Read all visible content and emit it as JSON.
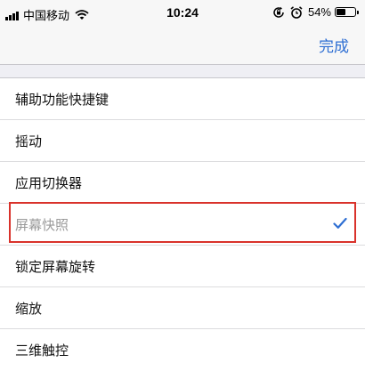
{
  "status_bar": {
    "carrier": "中国移动",
    "time": "10:24",
    "battery_percent": "54%",
    "battery_level": 0.54,
    "icons": [
      "signal-icon",
      "wifi-icon",
      "orientation-lock-icon",
      "alarm-icon",
      "battery-icon"
    ]
  },
  "nav": {
    "done_label": "完成"
  },
  "list": {
    "items": [
      {
        "label": "辅助功能快捷键",
        "selected": false
      },
      {
        "label": "摇动",
        "selected": false
      },
      {
        "label": "应用切换器",
        "selected": false
      },
      {
        "label": "屏幕快照",
        "selected": true
      },
      {
        "label": "锁定屏幕旋转",
        "selected": false
      },
      {
        "label": "缩放",
        "selected": false
      },
      {
        "label": "三维触控",
        "selected": false
      }
    ]
  },
  "colors": {
    "accent": "#2f6fd3",
    "highlight_border": "#d9322b",
    "background": "#efeff4"
  }
}
